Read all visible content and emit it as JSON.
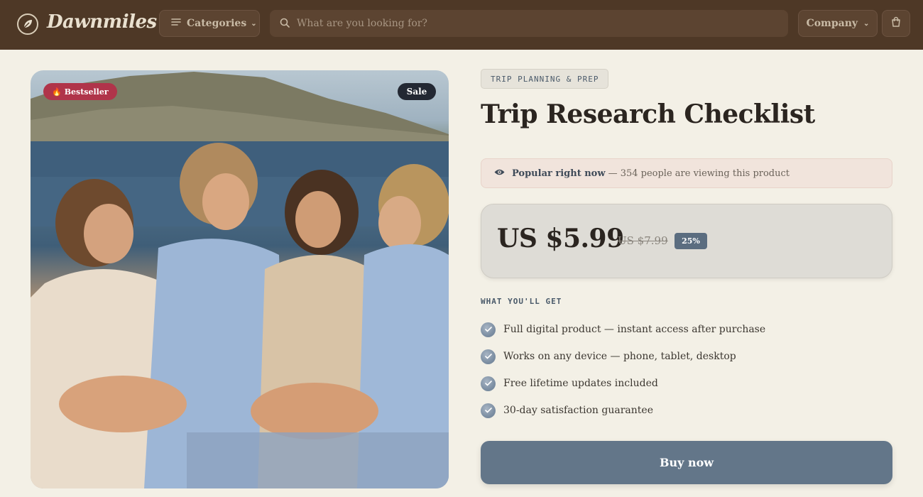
{
  "header": {
    "logo_text": "Dawnmiles",
    "categories_label": "Categories",
    "search_placeholder": "What are you looking for?",
    "company_label": "Company"
  },
  "photo": {
    "badge_bestseller": "Bestseller",
    "badge_sale": "Sale"
  },
  "product": {
    "category_tag": "TRIP PLANNING & PREP",
    "title": "Trip Research Checklist",
    "popular_strong": "Popular right now",
    "popular_rest": "— 354 people are viewing this product",
    "price": "US $5.99",
    "old_price": "US $7.99",
    "discount": "25%",
    "features_heading": "WHAT YOU'LL GET",
    "features": [
      "Full digital product — instant access after purchase",
      "Works on any device — phone, tablet, desktop",
      "Free lifetime updates included",
      "30-day satisfaction guarantee"
    ],
    "buy_label": "Buy now"
  },
  "colors": {
    "header_bg": "#4e3826",
    "page_bg": "#f3f0e6",
    "accent": "#637689",
    "bestseller": "#b0344a"
  }
}
